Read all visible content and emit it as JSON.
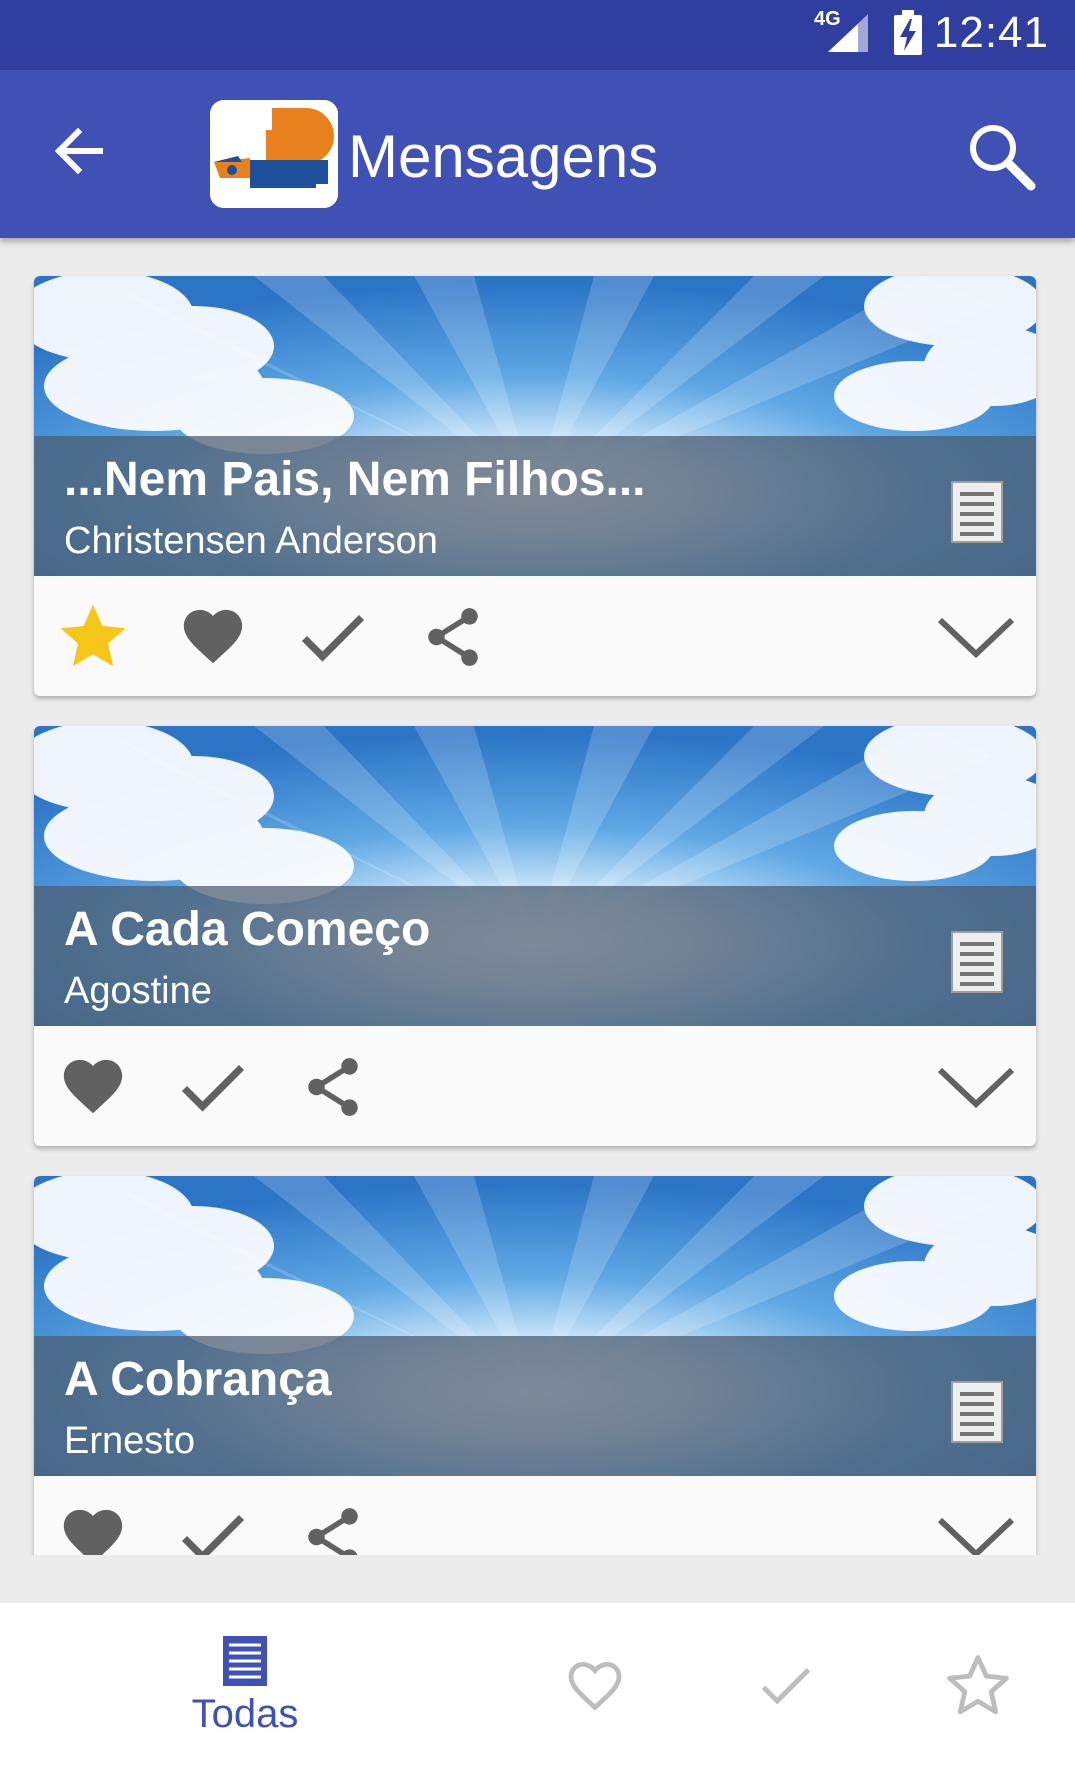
{
  "status_bar": {
    "network": "4G",
    "time": "12:41"
  },
  "app_bar": {
    "title": "Mensagens"
  },
  "messages": [
    {
      "title": "...Nem Pais, Nem Filhos...",
      "author": "Christensen Anderson",
      "starred": true
    },
    {
      "title": "A Cada Começo",
      "author": "Agostine",
      "starred": false
    },
    {
      "title": "A Cobrança",
      "author": "Ernesto",
      "starred": false
    }
  ],
  "bottom_nav": {
    "all_label": "Todas",
    "active_tab": "all"
  },
  "colors": {
    "primary": "#3f51b5",
    "primary_dark": "#303f9f",
    "star_active": "#f5c518",
    "icon_gray": "#616161",
    "nav_inactive": "#bdbdbd"
  },
  "icons": [
    "back-arrow-icon",
    "search-icon",
    "document-icon",
    "star-icon",
    "heart-icon",
    "check-icon",
    "share-icon",
    "chevron-down-icon"
  ]
}
